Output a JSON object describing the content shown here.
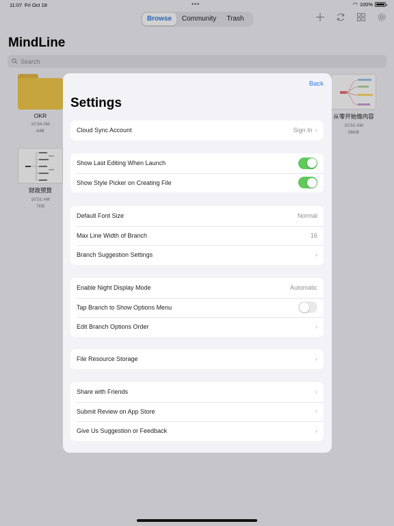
{
  "status_bar": {
    "time": "11:07",
    "date": "Fri Oct 18",
    "battery": "100%"
  },
  "segments": [
    {
      "label": "Browse",
      "active": true
    },
    {
      "label": "Community",
      "active": false
    },
    {
      "label": "Trash",
      "active": false
    }
  ],
  "toolbar_icons": [
    "add-icon",
    "sync-icon",
    "grid-view-icon",
    "settings-gear-icon"
  ],
  "app": {
    "title": "MindLine",
    "search_placeholder": "Search"
  },
  "files": [
    {
      "name": "OKR",
      "time": "10:54 AM",
      "size": "64B",
      "type": "folder"
    },
    {
      "name": "从零开始做内容",
      "time": "10:51 AM",
      "size": "56KB",
      "type": "mindmap"
    },
    {
      "name": "财政预算",
      "time": "10:51 AM",
      "size": "7KB",
      "type": "mindmap"
    }
  ],
  "settings": {
    "back_label": "Back",
    "title": "Settings",
    "groups": [
      {
        "rows": [
          {
            "label": "Cloud Sync Account",
            "value": "Sign In"
          }
        ]
      },
      {
        "rows": [
          {
            "label": "Show Last Editing When Launch",
            "toggle": "on"
          },
          {
            "label": "Show Style Picker on Creating File",
            "toggle": "on"
          }
        ]
      },
      {
        "rows": [
          {
            "label": "Default Font Size",
            "value": "Normal"
          },
          {
            "label": "Max Line Width of Branch",
            "value": "16"
          },
          {
            "label": "Branch Suggestion Settings"
          }
        ]
      },
      {
        "rows": [
          {
            "label": "Enable Night Display Mode",
            "value": "Automatic"
          },
          {
            "label": "Tap Branch to Show Options Menu",
            "toggle": "off"
          },
          {
            "label": "Edit Branch Options Order"
          }
        ]
      },
      {
        "rows": [
          {
            "label": "File Resource Storage"
          }
        ]
      },
      {
        "rows": [
          {
            "label": "Share with Friends"
          },
          {
            "label": "Submit Review on App Store"
          },
          {
            "label": "Give Us Suggestion or Feedback"
          }
        ]
      }
    ]
  },
  "colors": {
    "accent": "#2f7ae5",
    "toggle_on": "#5fc95b",
    "folder": "#f2c94c"
  }
}
